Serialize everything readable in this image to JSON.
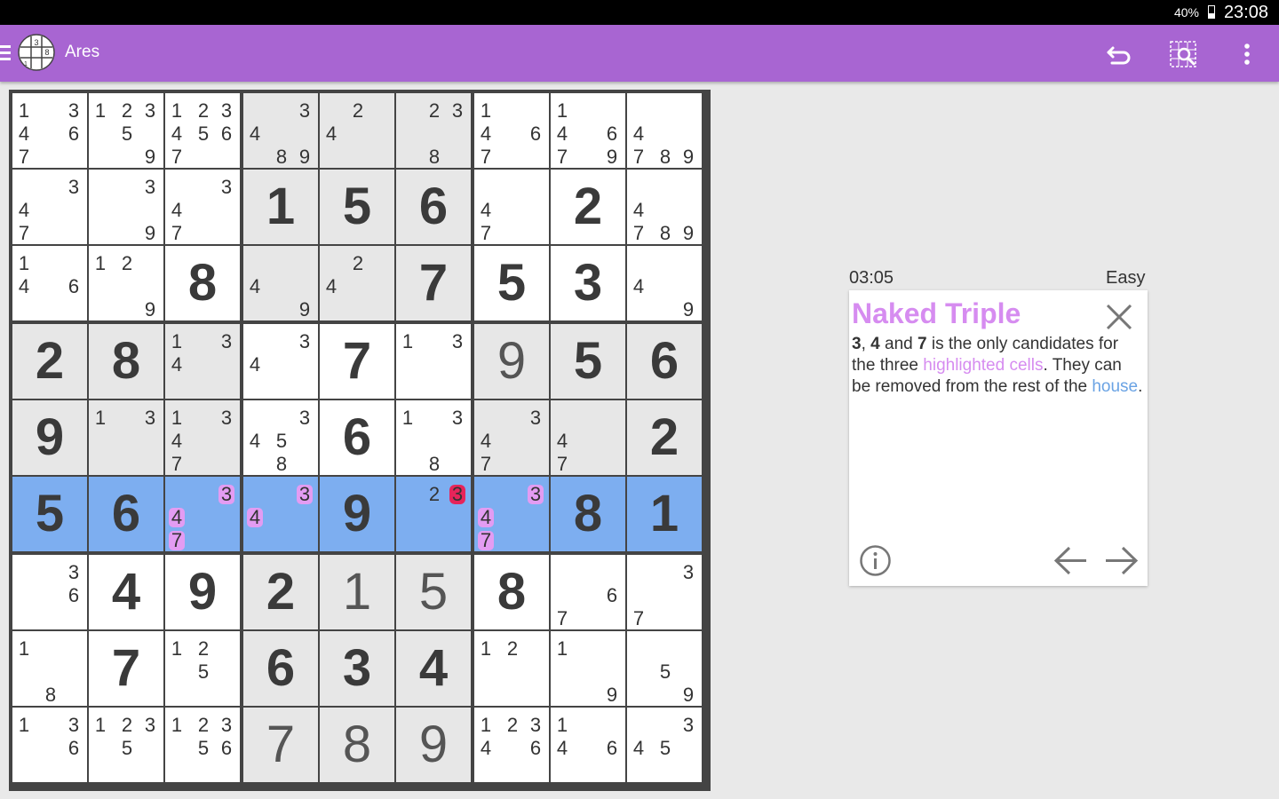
{
  "status_bar": {
    "battery": "40%",
    "time": "23:08"
  },
  "app_bar": {
    "title": "Ares",
    "icons": [
      "menu-icon",
      "app-logo-icon",
      "undo-icon",
      "hint-search-icon",
      "more-vert-icon"
    ]
  },
  "game": {
    "timer": "03:05",
    "difficulty": "Easy",
    "colors": {
      "cell_white": "#ffffff",
      "cell_gray": "#e7e7e7",
      "row_highlight": "#7daef0",
      "candidate_highlight": "#e39cf2",
      "candidate_eliminate": "#e6245a",
      "accent": "#a865d2"
    },
    "grid": [
      [
        {
          "c": [
            1,
            3,
            4,
            6,
            7
          ]
        },
        {
          "c": [
            1,
            2,
            3,
            5,
            9
          ]
        },
        {
          "c": [
            1,
            2,
            3,
            4,
            5,
            6,
            7
          ]
        },
        {
          "c": [
            3,
            4,
            8,
            9
          ]
        },
        {
          "c": [
            2,
            4
          ]
        },
        {
          "c": [
            2,
            3,
            8
          ]
        },
        {
          "c": [
            1,
            4,
            6,
            7
          ]
        },
        {
          "c": [
            1,
            4,
            6,
            7,
            9
          ]
        },
        {
          "c": [
            4,
            7,
            8,
            9
          ]
        }
      ],
      [
        {
          "c": [
            3,
            4,
            7
          ]
        },
        {
          "c": [
            3,
            9
          ]
        },
        {
          "c": [
            3,
            4,
            7
          ]
        },
        {
          "v": 1,
          "g": true
        },
        {
          "v": 5,
          "g": true
        },
        {
          "v": 6,
          "g": true
        },
        {
          "c": [
            4,
            7
          ]
        },
        {
          "v": 2,
          "g": true
        },
        {
          "c": [
            4,
            7,
            8,
            9
          ]
        }
      ],
      [
        {
          "c": [
            1,
            4,
            6
          ]
        },
        {
          "c": [
            1,
            2,
            9
          ]
        },
        {
          "v": 8,
          "g": true
        },
        {
          "c": [
            4,
            9
          ]
        },
        {
          "c": [
            2,
            4
          ]
        },
        {
          "v": 7,
          "g": true
        },
        {
          "v": 5,
          "g": true
        },
        {
          "v": 3,
          "g": true
        },
        {
          "c": [
            4,
            9
          ]
        }
      ],
      [
        {
          "v": 2,
          "g": true
        },
        {
          "v": 8,
          "g": true
        },
        {
          "c": [
            1,
            3,
            4
          ]
        },
        {
          "c": [
            3,
            4
          ]
        },
        {
          "v": 7,
          "g": true
        },
        {
          "c": [
            1,
            3
          ]
        },
        {
          "v": 9,
          "g": false
        },
        {
          "v": 5,
          "g": true
        },
        {
          "v": 6,
          "g": true
        }
      ],
      [
        {
          "v": 9,
          "g": true
        },
        {
          "c": [
            1,
            3
          ]
        },
        {
          "c": [
            1,
            3,
            4,
            7
          ]
        },
        {
          "c": [
            3,
            4,
            5,
            8
          ]
        },
        {
          "v": 6,
          "g": true
        },
        {
          "c": [
            1,
            3,
            8
          ]
        },
        {
          "c": [
            3,
            4,
            7
          ]
        },
        {
          "c": [
            4,
            7
          ]
        },
        {
          "v": 2,
          "g": true
        }
      ],
      [
        {
          "v": 5,
          "g": true
        },
        {
          "v": 6,
          "g": true
        },
        {
          "c": [
            3,
            4,
            7
          ],
          "h": [
            3,
            4,
            7
          ]
        },
        {
          "c": [
            3,
            4
          ],
          "h": [
            3,
            4
          ]
        },
        {
          "v": 9,
          "g": true
        },
        {
          "c": [
            2,
            3
          ],
          "e": [
            3
          ]
        },
        {
          "c": [
            3,
            4,
            7
          ],
          "h": [
            3,
            4,
            7
          ]
        },
        {
          "v": 8,
          "g": true
        },
        {
          "v": 1,
          "g": true
        }
      ],
      [
        {
          "c": [
            3,
            6
          ]
        },
        {
          "v": 4,
          "g": true
        },
        {
          "v": 9,
          "g": true
        },
        {
          "v": 2,
          "g": true
        },
        {
          "v": 1,
          "g": false
        },
        {
          "v": 5,
          "g": false
        },
        {
          "v": 8,
          "g": true
        },
        {
          "c": [
            6,
            7
          ]
        },
        {
          "c": [
            3,
            7
          ]
        }
      ],
      [
        {
          "c": [
            1,
            8
          ]
        },
        {
          "v": 7,
          "g": true
        },
        {
          "c": [
            1,
            2,
            5
          ]
        },
        {
          "v": 6,
          "g": true
        },
        {
          "v": 3,
          "g": true
        },
        {
          "v": 4,
          "g": true
        },
        {
          "c": [
            1,
            2
          ]
        },
        {
          "c": [
            1,
            9
          ]
        },
        {
          "c": [
            5,
            9
          ]
        }
      ],
      [
        {
          "c": [
            1,
            3,
            6
          ]
        },
        {
          "c": [
            1,
            2,
            3,
            5
          ]
        },
        {
          "c": [
            1,
            2,
            3,
            5,
            6
          ]
        },
        {
          "v": 7,
          "g": false
        },
        {
          "v": 8,
          "g": false
        },
        {
          "v": 9,
          "g": false
        },
        {
          "c": [
            1,
            2,
            3,
            4,
            6
          ]
        },
        {
          "c": [
            1,
            4,
            6
          ]
        },
        {
          "c": [
            3,
            4,
            5
          ]
        }
      ]
    ],
    "gray_boxes": [
      1,
      3,
      5,
      7
    ],
    "highlight_row": 5
  },
  "hint": {
    "title": "Naked Triple",
    "body": {
      "n1": "3",
      "sep1": ", ",
      "n2": "4",
      "sep2": " and ",
      "n3": "7",
      "t1": " is the only candidates for the three ",
      "link1": "highlighted cells",
      "t2": ". They can be removed from the rest of the ",
      "link2": "house",
      "t3": "."
    },
    "icons": [
      "close-icon",
      "info-icon",
      "prev-arrow-icon",
      "next-arrow-icon"
    ]
  }
}
